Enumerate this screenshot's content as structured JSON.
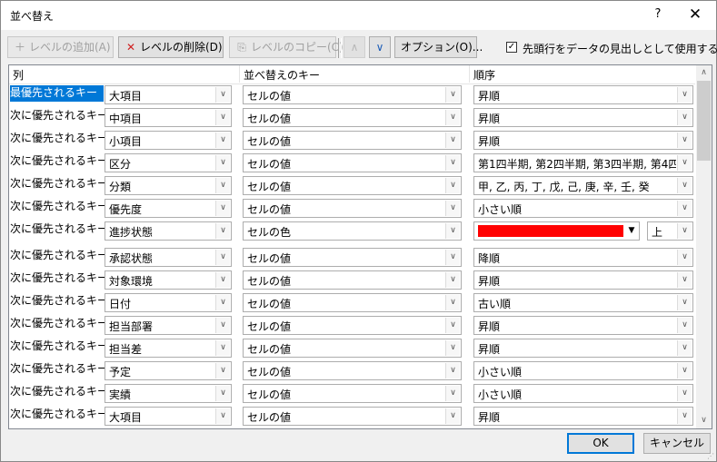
{
  "window": {
    "title": "並べ替え",
    "help_glyph": "?",
    "close_glyph": "✕"
  },
  "toolbar": {
    "add_level": {
      "icon": "＋",
      "label": "レベルの追加(A)"
    },
    "delete_level": {
      "icon": "✕",
      "label": "レベルの削除(D)"
    },
    "copy_level": {
      "icon": "⎘",
      "label": "レベルのコピー(C)"
    },
    "move_up_glyph": "∧",
    "move_down_glyph": "∨",
    "options_label": "オプション(O)...",
    "header_checkbox": {
      "checked": true,
      "check_glyph": "✓",
      "label": "先頭行をデータの見出しとして使用する(H)"
    }
  },
  "grid": {
    "headers": {
      "column": "列",
      "sort_on": "並べ替えのキー",
      "order": "順序"
    },
    "rows": [
      {
        "label": "最優先されるキー",
        "column": "大項目",
        "sort_on": "セルの値",
        "order": "昇順"
      },
      {
        "label": "次に優先されるキー",
        "column": "中項目",
        "sort_on": "セルの値",
        "order": "昇順"
      },
      {
        "label": "次に優先されるキー",
        "column": "小項目",
        "sort_on": "セルの値",
        "order": "昇順"
      },
      {
        "label": "次に優先されるキー",
        "column": "区分",
        "sort_on": "セルの値",
        "order": "第1四半期, 第2四半期, 第3四半期, 第4四"
      },
      {
        "label": "次に優先されるキー",
        "column": "分類",
        "sort_on": "セルの値",
        "order": "甲, 乙, 丙, 丁, 戊, 己, 庚, 辛, 壬, 癸"
      },
      {
        "label": "次に優先されるキー",
        "column": "優先度",
        "sort_on": "セルの値",
        "order": "小さい順"
      },
      {
        "label": "次に優先されるキー",
        "column": "進捗状態",
        "sort_on": "セルの色",
        "order_color": "#ff0000",
        "position": "上"
      },
      {
        "label": "次に優先されるキー",
        "column": "承認状態",
        "sort_on": "セルの値",
        "order": "降順"
      },
      {
        "label": "次に優先されるキー",
        "column": "対象環境",
        "sort_on": "セルの値",
        "order": "昇順"
      },
      {
        "label": "次に優先されるキー",
        "column": "日付",
        "sort_on": "セルの値",
        "order": "古い順"
      },
      {
        "label": "次に優先されるキー",
        "column": "担当部署",
        "sort_on": "セルの値",
        "order": "昇順"
      },
      {
        "label": "次に優先されるキー",
        "column": "担当差",
        "sort_on": "セルの値",
        "order": "昇順"
      },
      {
        "label": "次に優先されるキー",
        "column": "予定",
        "sort_on": "セルの値",
        "order": "小さい順"
      },
      {
        "label": "次に優先されるキー",
        "column": "実績",
        "sort_on": "セルの値",
        "order": "小さい順"
      },
      {
        "label": "次に優先されるキー",
        "column": "大項目",
        "sort_on": "セルの値",
        "order": "昇順"
      }
    ]
  },
  "icons": {
    "dropdown_glyph": "∨",
    "scroll_up_glyph": "∧",
    "scroll_down_glyph": "∨",
    "color_dropdown_glyph": "▼"
  },
  "colors": {
    "selection": "#0078d7",
    "default_border": "#0078d7"
  },
  "footer": {
    "ok_label": "OK",
    "cancel_label": "キャンセル"
  }
}
